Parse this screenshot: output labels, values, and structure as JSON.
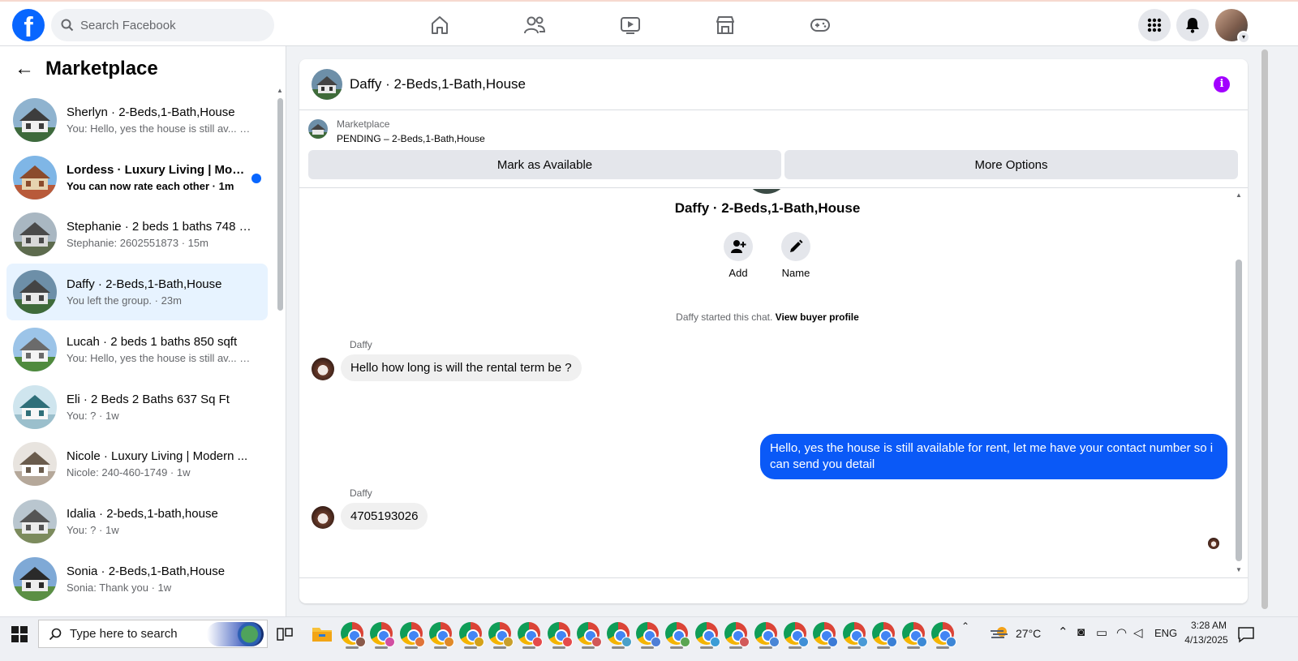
{
  "topbar": {
    "search_placeholder": "Search Facebook",
    "nav_icons": [
      "home-icon",
      "friends-icon",
      "video-icon",
      "marketplace-icon",
      "gaming-icon"
    ],
    "right_icons": [
      "menu-grid-icon",
      "notifications-bell-icon",
      "account-avatar"
    ]
  },
  "sidebar": {
    "title": "Marketplace",
    "conversations": [
      {
        "name": "Sherlyn · 2-Beds,1-Bath,House",
        "preview": "You: Hello, yes the house is still av...",
        "time": " · 1m",
        "unread": false,
        "active": false
      },
      {
        "name": "Lordess · Luxury Living | Mode...",
        "preview": "You can now rate each other",
        "time": " · 1m",
        "unread": true,
        "active": false
      },
      {
        "name": "Stephanie · 2 beds 1 baths 748 s...",
        "preview": "Stephanie: 2602551873",
        "time": " · 15m",
        "unread": false,
        "active": false
      },
      {
        "name": "Daffy · 2-Beds,1-Bath,House",
        "preview": "You left the group.",
        "time": " · 23m",
        "unread": false,
        "active": true
      },
      {
        "name": "Lucah · 2 beds 1 baths 850 sqft",
        "preview": "You: Hello, yes the house is still av...",
        "time": " · 23h",
        "unread": false,
        "active": false
      },
      {
        "name": "Eli · 2 Beds 2 Baths 637 Sq Ft",
        "preview": "You: ?",
        "time": " · 1w",
        "unread": false,
        "active": false
      },
      {
        "name": "Nicole · Luxury Living | Modern ...",
        "preview": "Nicole: 240-460-1749",
        "time": " · 1w",
        "unread": false,
        "active": false
      },
      {
        "name": "Idalia · 2-beds,1-bath,house",
        "preview": "You: ?",
        "time": " · 1w",
        "unread": false,
        "active": false
      },
      {
        "name": "Sonia · 2-Beds,1-Bath,House",
        "preview": "Sonia: Thank you",
        "time": " · 1w",
        "unread": false,
        "active": false
      }
    ]
  },
  "chat": {
    "title": "Daffy · 2-Beds,1-Bath,House",
    "marketplace_label": "Marketplace",
    "listing_status": "PENDING – 2-Beds,1-Bath,House",
    "mark_available_label": "Mark as Available",
    "more_options_label": "More Options",
    "group_title": "Daffy · 2-Beds,1-Bath,House",
    "add_label": "Add",
    "name_label": "Name",
    "started_text": "Daffy started this chat. ",
    "view_profile_label": "View buyer profile",
    "messages": [
      {
        "sender": "Daffy",
        "text": "Hello how long is will the rental term be ?",
        "outgoing": false
      },
      {
        "sender": "",
        "text": "Hello, yes the house is still available for rent, let me have your contact number so i can send you detail",
        "outgoing": true
      },
      {
        "sender": "Daffy",
        "text": "4705193026",
        "outgoing": false
      }
    ]
  },
  "taskbar": {
    "search_placeholder": "Type here to search",
    "temperature": "27°C",
    "language": "ENG",
    "time": "3:28 AM",
    "date": "4/13/2025"
  },
  "colors": {
    "brand": "#0866ff",
    "outgoing_bubble": "#0a59f7",
    "info_icon": "#a200ff",
    "active_row": "#e7f3ff"
  }
}
